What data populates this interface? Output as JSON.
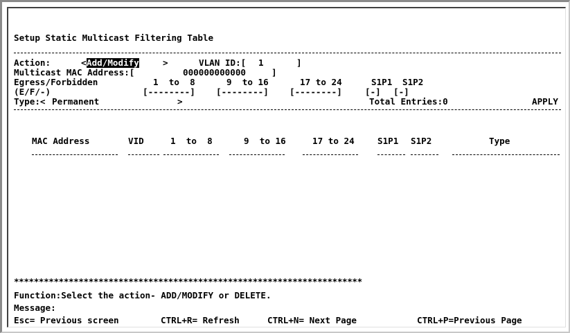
{
  "title": "Setup Static Multicast Filtering Table",
  "action": {
    "label": "Action: ",
    "open": "<",
    "value": "Add/Modify",
    "close": ">"
  },
  "vlan": {
    "label": "VLAN ID:[",
    "value": "1   ",
    "close": "]"
  },
  "mac": {
    "label": "Multicast MAC Address:[",
    "value": "000000000000",
    "close": "]"
  },
  "egress": {
    "label": "Egress/Forbidden",
    "range1": "1  to  8",
    "range2": "9  to 16",
    "range3": "17 to 24",
    "s1p1": "S1P1",
    "s1p2": "S1P2"
  },
  "efd": {
    "label": "(E/F/-)",
    "g1": "[--------]",
    "g2": "[--------]",
    "g3": "[--------]",
    "g4": "[-]",
    "g5": "[-]"
  },
  "type_field": {
    "label": "Type:<",
    "value": "Permanent",
    "close": ">"
  },
  "total_entries": "Total Entries:0",
  "apply": "APPLY",
  "table": {
    "headers": {
      "mac": "MAC Address",
      "vid": "VID",
      "r1": "1  to  8",
      "r2": "9  to 16",
      "r3": "17 to 24",
      "s1p1": "S1P1",
      "s1p2": "S1P2",
      "type": "Type"
    },
    "rows": []
  },
  "separator_stars": "**********************************************************************",
  "function_text": "Function:Select the action- ADD/MODIFY or DELETE.",
  "message_label": "Message:",
  "footer": {
    "esc": "Esc= Previous screen",
    "refresh": "CTRL+R= Refresh",
    "next": "CTRL+N= Next Page",
    "prev": "CTRL+P=Previous Page"
  }
}
